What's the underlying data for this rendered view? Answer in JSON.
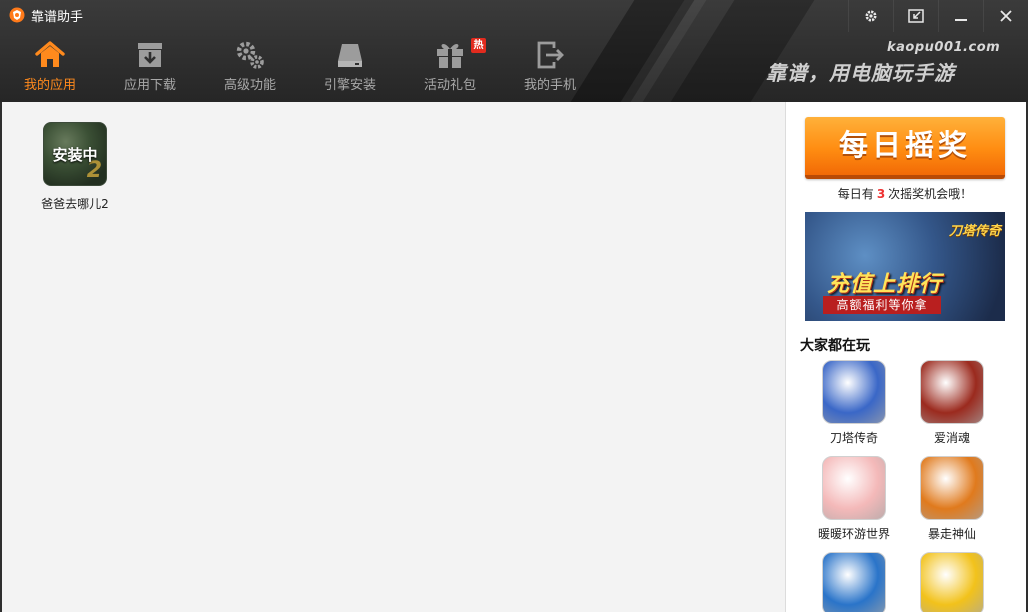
{
  "window": {
    "title": "靠谱助手",
    "logo_icon": "kaopu-logo-icon"
  },
  "window_controls": [
    {
      "name": "settings-button",
      "icon": "gear-icon"
    },
    {
      "name": "mini-mode-button",
      "icon": "shrink-icon"
    },
    {
      "name": "minimize-button",
      "icon": "minimize-icon"
    },
    {
      "name": "close-button",
      "icon": "close-icon"
    }
  ],
  "nav": [
    {
      "label": "我的应用",
      "icon": "home-icon",
      "active": true
    },
    {
      "label": "应用下载",
      "icon": "download-box-icon"
    },
    {
      "label": "高级功能",
      "icon": "gears-icon"
    },
    {
      "label": "引擎安装",
      "icon": "engine-icon"
    },
    {
      "label": "活动礼包",
      "icon": "gift-icon",
      "badge": "热"
    },
    {
      "label": "我的手机",
      "icon": "phone-export-icon"
    }
  ],
  "brand": {
    "url": "kaopu001.com",
    "slogan": "靠谱，用电脑玩手游"
  },
  "colors": {
    "accent": "#ff8a1d",
    "header_bg": "#2e2e2e",
    "badge": "#e22b1e"
  },
  "my_apps": [
    {
      "name": "爸爸去哪儿2",
      "status": "安装中",
      "corner_mark": "2"
    }
  ],
  "sidebar": {
    "lottery_label": "每日摇奖",
    "lottery_note_prefix": "每日有",
    "lottery_count": "3",
    "lottery_note_suffix": "次摇奖机会哦！",
    "banner": {
      "logo_text": "刀塔传奇",
      "headline": "充值上排行",
      "subline": "高额福利等你拿"
    },
    "section_title": "大家都在玩",
    "games": [
      {
        "name": "刀塔传奇",
        "color": "#3a67c7"
      },
      {
        "name": "爱消魂",
        "color": "#9b2a1e"
      },
      {
        "name": "暖暖环游世界",
        "color": "#f4b9b9"
      },
      {
        "name": "暴走神仙",
        "color": "#e07a1d"
      },
      {
        "name": "",
        "color": "#2a74c9"
      },
      {
        "name": "",
        "color": "#f2c21b"
      }
    ]
  }
}
